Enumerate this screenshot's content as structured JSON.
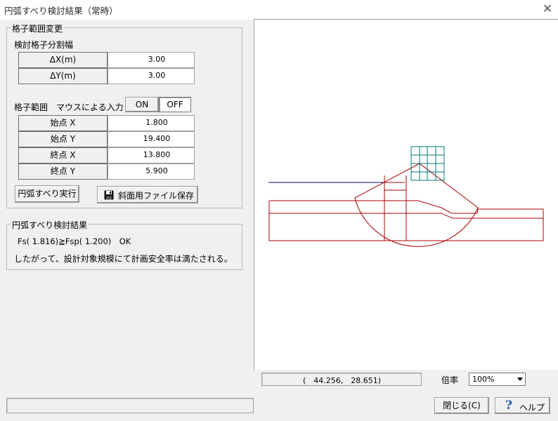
{
  "window": {
    "title": "円弧すべり検討結果（常時）"
  },
  "grid_change": {
    "legend": "格子範囲変更",
    "division_label": "検討格子分割幅",
    "dx_label": "ΔX(m)",
    "dx_value": "3.00",
    "dy_label": "ΔY(m)",
    "dy_value": "3.00",
    "range_label": "格子範囲",
    "mouse_label": "マウスによる入力",
    "on_label": "ON",
    "off_label": "OFF",
    "start_x_label": "始点 X",
    "start_x_value": "1.800",
    "start_y_label": "始点 Y",
    "start_y_value": "19.400",
    "end_x_label": "終点 X",
    "end_x_value": "13.800",
    "end_y_label": "終点 Y",
    "end_y_value": "5.900",
    "run_label": "円弧すべり実行",
    "save_label": "斜面用ファイル保存"
  },
  "result": {
    "legend": "円弧すべり検討結果",
    "line1": "Fs( 1.816)≧Fsp( 1.200)　OK",
    "line2": "したがって、設計対象規模にて計画安全率は満たされる。"
  },
  "viewer": {
    "coords": "(　44.256,　28.651)",
    "zoom_label": "倍率",
    "zoom_value": "100%"
  },
  "footer": {
    "close_label": "閉じる(C)",
    "help_label": "ヘルプ"
  },
  "colors": {
    "structure": "#aa0000",
    "water_line": "#000080",
    "grid": "#007a7a"
  }
}
